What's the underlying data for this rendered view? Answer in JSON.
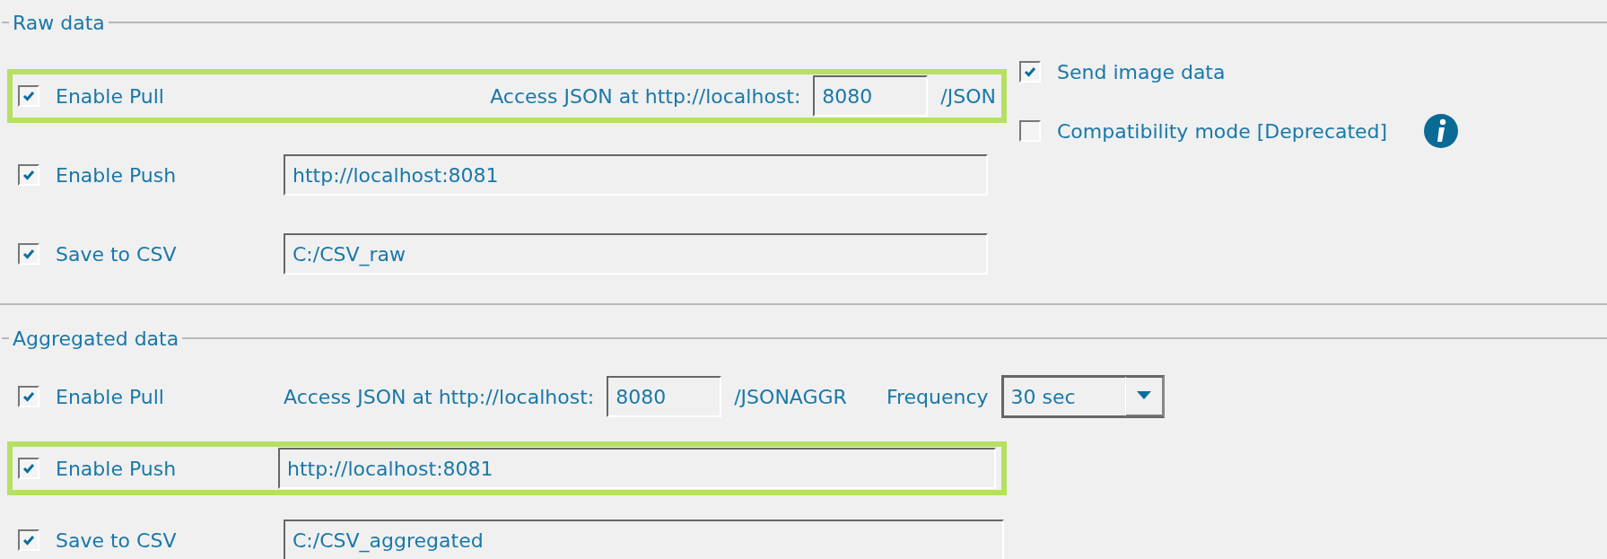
{
  "sections": [
    {
      "title": "Raw data",
      "rows": [
        {
          "kind": "pull",
          "label": "Enable Pull",
          "checked": true,
          "highlighted": true,
          "prompt": "Access JSON at http://localhost:",
          "port": "8080",
          "suffix": "/JSON"
        },
        {
          "kind": "url",
          "label": "Enable Push",
          "checked": true,
          "highlighted": false,
          "value": "http://localhost:8081"
        },
        {
          "kind": "url",
          "label": "Save to CSV",
          "checked": true,
          "highlighted": false,
          "value": "C:/CSV_raw"
        }
      ],
      "options": [
        {
          "label": "Send image data",
          "checked": true,
          "info": false
        },
        {
          "label": "Compatibility mode [Deprecated]",
          "checked": false,
          "info": true
        }
      ]
    },
    {
      "title": "Aggregated data",
      "rows": [
        {
          "kind": "pull",
          "label": "Enable Pull",
          "checked": true,
          "highlighted": false,
          "prompt": "Access JSON at http://localhost:",
          "port": "8080",
          "suffix": "/JSONAGGR",
          "frequency_label": "Frequency",
          "frequency": "30 sec"
        },
        {
          "kind": "url",
          "label": "Enable Push",
          "checked": true,
          "highlighted": true,
          "value": "http://localhost:8081"
        },
        {
          "kind": "url",
          "label": "Save to CSV",
          "checked": true,
          "highlighted": false,
          "value": "C:/CSV_aggregated"
        }
      ]
    }
  ]
}
